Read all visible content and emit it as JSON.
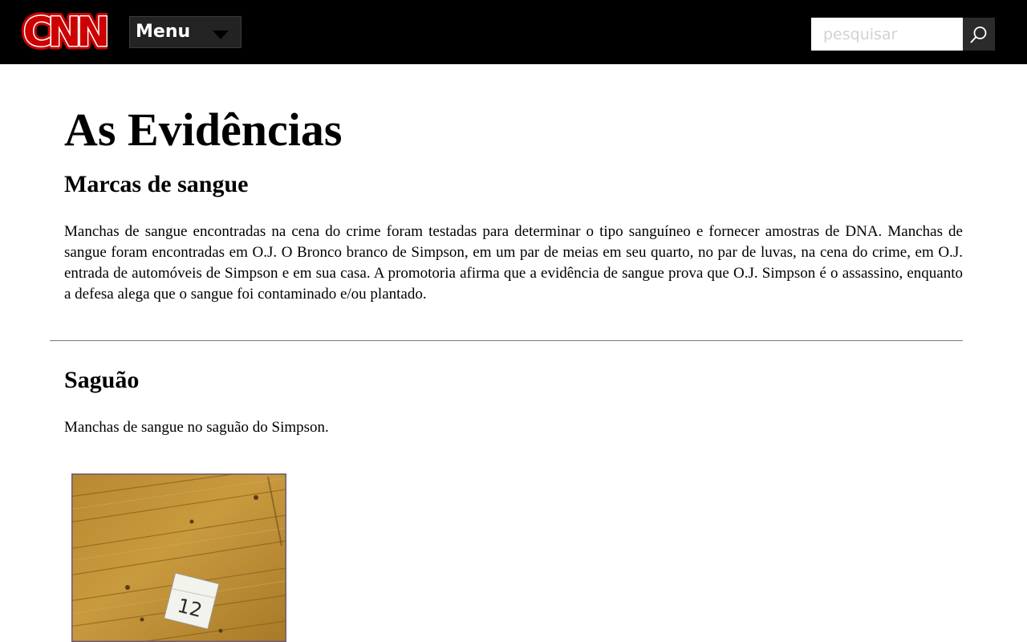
{
  "header": {
    "logo_text": "CNN",
    "menu_label": "Menu",
    "search": {
      "placeholder": "pesquisar",
      "value": ""
    }
  },
  "page": {
    "title": "As Evidências",
    "section": {
      "heading": "Marcas de sangue",
      "body": "Manchas de sangue encontradas na cena do crime foram testadas para determinar o tipo sanguíneo e fornecer amostras de DNA. Manchas de sangue foram encontradas em O.J. O Bronco branco de Simpson, em um par de meias em seu quarto, no par de luvas, na cena do crime, em O.J. entrada de automóveis de Simpson e em sua casa. A promotoria afirma que a evidência de sangue prova que O.J. Simpson é o assassino, enquanto a defesa alega que o sangue foi contaminado e/ou plantado."
    },
    "subsection": {
      "heading": "Saguão",
      "body": "Manchas de sangue no saguão do Simpson.",
      "photo_marker_text": "12"
    }
  },
  "colors": {
    "header_bg": "#000000",
    "logo_red": "#cc0000",
    "menu_bg": "#232323",
    "search_button_bg": "#2b2b2b",
    "divider": "#7a7a7a"
  },
  "icons": {
    "logo": "cnn-logo",
    "menu": "chevron-down-icon",
    "search": "search-icon"
  }
}
